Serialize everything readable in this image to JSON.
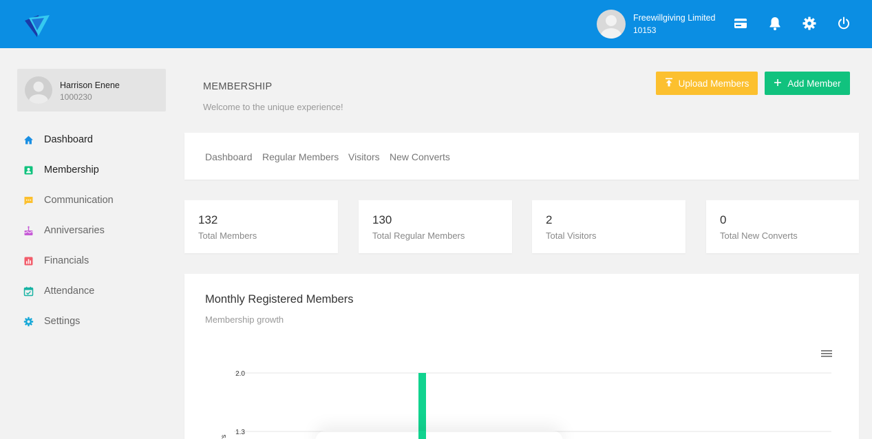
{
  "header": {
    "org_name": "Freewillgiving Limited",
    "org_id": "10153",
    "icons": [
      "credit-card-icon",
      "bell-icon",
      "gear-icon",
      "power-icon"
    ]
  },
  "profile": {
    "name": "Harrison Enene",
    "id": "1000230"
  },
  "sidebar": {
    "items": [
      {
        "label": "Dashboard",
        "icon": "home-icon",
        "color": "#1a8fe3"
      },
      {
        "label": "Membership",
        "icon": "contact-icon",
        "color": "#11c27e"
      },
      {
        "label": "Communication",
        "icon": "chat-icon",
        "color": "#fcc02f"
      },
      {
        "label": "Anniversaries",
        "icon": "cake-icon",
        "color": "#c65bd6"
      },
      {
        "label": "Financials",
        "icon": "bar-chart-icon",
        "color": "#f25c6a"
      },
      {
        "label": "Attendance",
        "icon": "calendar-check-icon",
        "color": "#17b3a3"
      },
      {
        "label": "Settings",
        "icon": "gear-icon",
        "color": "#17a8d8"
      }
    ]
  },
  "page": {
    "title": "MEMBERSHIP",
    "subtitle": "Welcome to the unique experience!"
  },
  "actions": {
    "upload_label": "Upload Members",
    "add_label": "Add Member",
    "upload_color": "#fcc02f",
    "add_color": "#11c27e"
  },
  "tabs": [
    "Dashboard",
    "Regular Members",
    "Visitors",
    "New Converts"
  ],
  "stats": [
    {
      "value": "132",
      "label": "Total Members"
    },
    {
      "value": "130",
      "label": "Total Regular Members"
    },
    {
      "value": "2",
      "label": "Total Visitors"
    },
    {
      "value": "0",
      "label": "Total New Converts"
    }
  ],
  "chart": {
    "title": "Monthly Registered Members",
    "subtitle": "Membership growth"
  },
  "chart_data": {
    "type": "bar",
    "title": "Monthly Registered Members",
    "subtitle": "Membership growth",
    "y_ticks": [
      "2.0",
      "1.3"
    ],
    "ylabel_fragment": "rs",
    "ylim": [
      0,
      2.0
    ],
    "series": [
      {
        "values": [
          2.0
        ],
        "color": "#11d38f"
      }
    ],
    "grid": true
  }
}
